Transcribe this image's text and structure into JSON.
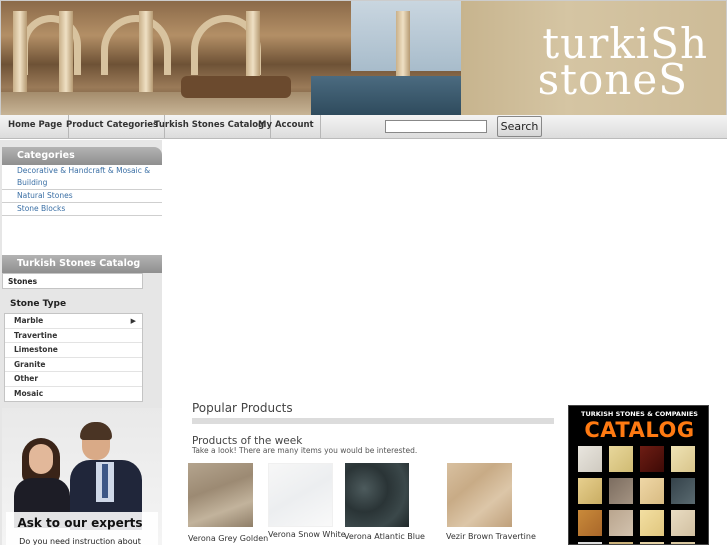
{
  "banner": {
    "logo_top": "turkiSh",
    "logo_bottom": "stoneS"
  },
  "nav": {
    "items": [
      {
        "label": "Home Page"
      },
      {
        "label": "Product Categories"
      },
      {
        "label": "Turkish Stones Catalog"
      },
      {
        "label": "My Account"
      }
    ],
    "search_value": "",
    "search_button": "Search"
  },
  "sidebar": {
    "categories_title": "Categories",
    "categories": [
      {
        "label": "Decorative & Handcraft & Mosaic & Building"
      },
      {
        "label": "Natural Stones"
      },
      {
        "label": "Stone Blocks"
      }
    ],
    "catalog_title": "Turkish Stones Catalog",
    "stones_tab": "Stones",
    "stone_type_title": "Stone Type",
    "stone_types": [
      {
        "label": "Marble",
        "has_submenu": true
      },
      {
        "label": "Travertine"
      },
      {
        "label": "Limestone"
      },
      {
        "label": "Granite"
      },
      {
        "label": "Other"
      },
      {
        "label": "Mosaic"
      }
    ],
    "experts_title": "Ask to our experts",
    "experts_text": "Do you need instruction about"
  },
  "main": {
    "popular_title": "Popular Products",
    "week_title": "Products of the week",
    "week_subtitle": "Take a look! There are many items you would be interested.",
    "products": [
      {
        "name": "Verona Grey Golden"
      },
      {
        "name": "Verona Snow White"
      },
      {
        "name": "Verona Atlantic Blue"
      },
      {
        "name": "Vezir Brown Travertine"
      }
    ]
  },
  "catalog_ad": {
    "line1": "TURKISH STONES & COMPANIES",
    "line2": "CATALOG"
  },
  "colors": {
    "accent_orange": "#ff7a12",
    "link_blue": "#3a6fa5",
    "header_gray": "#9f9f9f"
  }
}
